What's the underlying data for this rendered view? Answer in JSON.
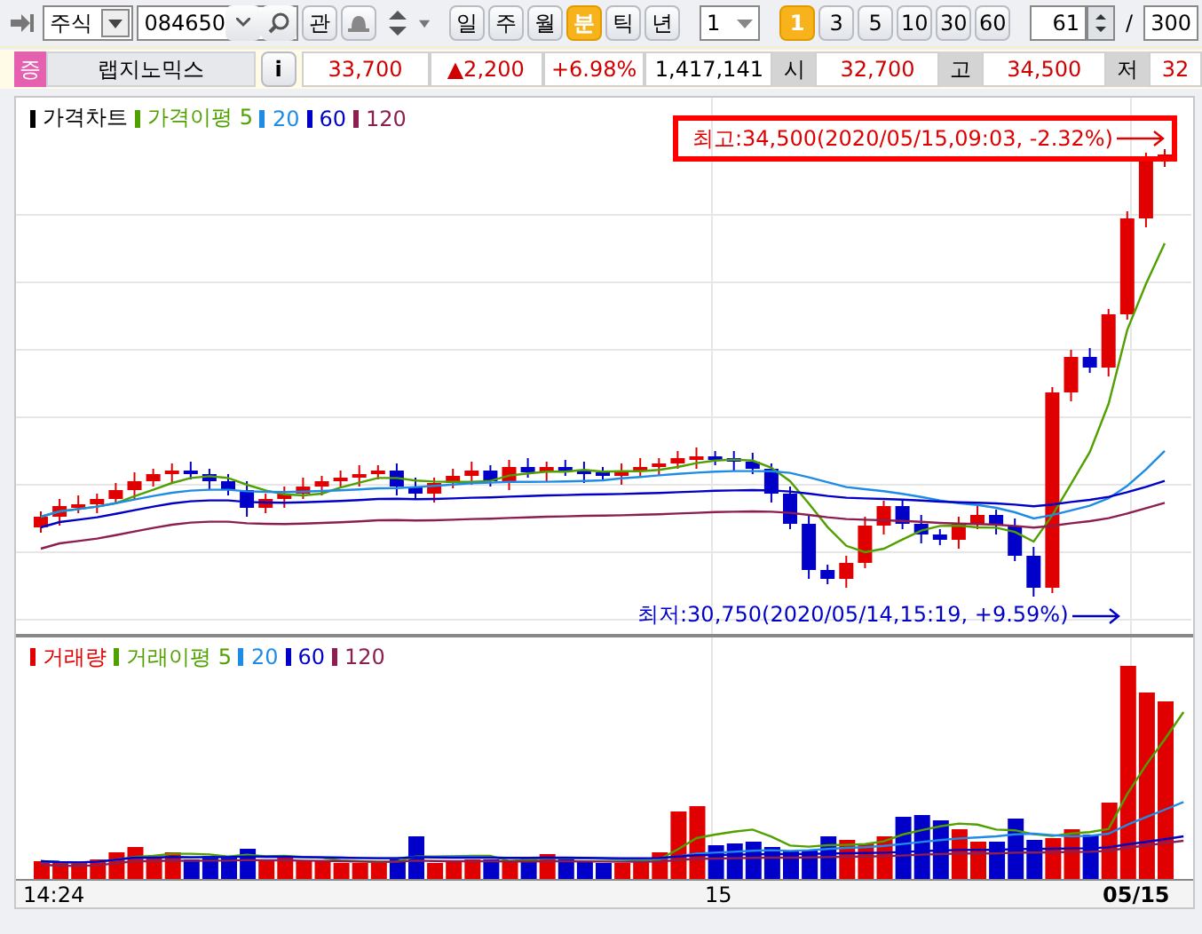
{
  "toolbar": {
    "market": {
      "value": "주식"
    },
    "code": {
      "value": "084650"
    },
    "watch_button": "관",
    "periods": [
      {
        "label": "일",
        "selected": false
      },
      {
        "label": "주",
        "selected": false
      },
      {
        "label": "월",
        "selected": false
      },
      {
        "label": "분",
        "selected": true
      },
      {
        "label": "틱",
        "selected": false
      },
      {
        "label": "년",
        "selected": false
      }
    ],
    "interval": {
      "value": "1"
    },
    "minutes": [
      {
        "label": "1",
        "selected": true
      },
      {
        "label": "3",
        "selected": false
      },
      {
        "label": "5",
        "selected": false
      },
      {
        "label": "10",
        "selected": false
      },
      {
        "label": "30",
        "selected": false
      },
      {
        "label": "60",
        "selected": false
      }
    ],
    "count": {
      "value": "61"
    },
    "separator": "/",
    "total": {
      "value": "300"
    }
  },
  "quote": {
    "badge": "증",
    "name": "랩지노믹스",
    "info_button": "i",
    "price": "33,700",
    "change": "▲2,200",
    "change_rate": "+6.98%",
    "volume": "1,417,141",
    "fields": [
      {
        "label": "시",
        "value": "32,700"
      },
      {
        "label": "고",
        "value": "34,500"
      },
      {
        "label": "저",
        "value": "32"
      }
    ]
  },
  "price_pane": {
    "legend": [
      {
        "label": "가격차트",
        "color": "#000000"
      },
      {
        "label": "가격이평 5",
        "color": "#50a000"
      },
      {
        "label": "20",
        "color": "#1e8ce6"
      },
      {
        "label": "60",
        "color": "#0000c8"
      },
      {
        "label": "120",
        "color": "#8c1e50"
      }
    ],
    "high_note": "최고:34,500(2020/05/15,09:03, -2.32%)",
    "low_note": "최저:30,750(2020/05/14,15:19, +9.59%)"
  },
  "volume_pane": {
    "legend": [
      {
        "label": "거래량",
        "color": "#e00000"
      },
      {
        "label": "거래이평 5",
        "color": "#50a000"
      },
      {
        "label": "20",
        "color": "#1e8ce6"
      },
      {
        "label": "60",
        "color": "#0000c8"
      },
      {
        "label": "120",
        "color": "#8c1e50"
      }
    ]
  },
  "x_axis": [
    {
      "label": "14:24",
      "bold": false
    },
    {
      "label": "15",
      "bold": false
    },
    {
      "label": "05/15",
      "bold": true
    }
  ]
}
